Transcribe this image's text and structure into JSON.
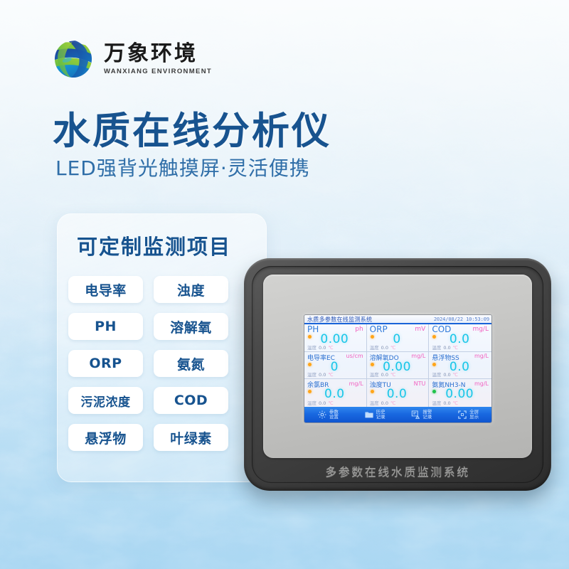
{
  "brand": {
    "logo_icon": "globe-swirl-logo-icon",
    "name_cn": "万象环境",
    "name_en": "WANXIANG ENVIRONMENT",
    "color_blue": "#1b4f9c",
    "color_green": "#8cc63e"
  },
  "hero": {
    "title": "水质在线分析仪",
    "subtitle": "LED强背光触摸屏·灵活便携",
    "title_color": "#18538f",
    "subtitle_color": "#2f6ea8"
  },
  "items_panel": {
    "title": "可定制监测项目",
    "tags": [
      {
        "label": "电导率"
      },
      {
        "label": "浊度"
      },
      {
        "label": "PH"
      },
      {
        "label": "溶解氧"
      },
      {
        "label": "ORP"
      },
      {
        "label": "氨氮"
      },
      {
        "label": "污泥浓度"
      },
      {
        "label": "COD"
      },
      {
        "label": "悬浮物"
      },
      {
        "label": "叶绿素"
      }
    ]
  },
  "device": {
    "caption": "多参数在线水质监测系统",
    "bezel_color": "#3e3e3e",
    "face_color": "#c6c6c4",
    "screen": {
      "system_title": "水质多参数在线监测系统",
      "timestamp": "2024/08/22 10:53:09",
      "accent_color": "#1963d8",
      "value_color": "#18c6e8",
      "unit_color": "#f261c0",
      "cells": [
        {
          "name": "PH",
          "unit": "ph",
          "value": "0.00",
          "temp_label": "温度",
          "temp_value": "0.0",
          "temp_unit": "℃",
          "status": "orange",
          "emphasis": "big"
        },
        {
          "name": "ORP",
          "unit": "mV",
          "value": "0",
          "temp_label": "温度",
          "temp_value": "0.0",
          "temp_unit": "℃",
          "status": "orange",
          "emphasis": "big"
        },
        {
          "name": "COD",
          "unit": "mg/L",
          "value": "0.0",
          "temp_label": "温度",
          "temp_value": "0.0",
          "temp_unit": "℃",
          "status": "orange",
          "emphasis": "big"
        },
        {
          "name": "电导率EC",
          "unit": "us/cm",
          "value": "0",
          "temp_label": "温度",
          "temp_value": "0.0",
          "temp_unit": "℃",
          "status": "orange",
          "emphasis": "small"
        },
        {
          "name": "溶解氧DO",
          "unit": "mg/L",
          "value": "0.00",
          "temp_label": "温度",
          "temp_value": "0.0",
          "temp_unit": "℃",
          "status": "orange",
          "emphasis": "small"
        },
        {
          "name": "悬浮物SS",
          "unit": "mg/L",
          "value": "0.0",
          "temp_label": "温度",
          "temp_value": "0.0",
          "temp_unit": "℃",
          "status": "orange",
          "emphasis": "small"
        },
        {
          "name": "余氯BR",
          "unit": "mg/L",
          "value": "0.0",
          "temp_label": "温度",
          "temp_value": "0.0",
          "temp_unit": "℃",
          "status": "orange",
          "emphasis": "small"
        },
        {
          "name": "浊度TU",
          "unit": "NTU",
          "value": "0.0",
          "temp_label": "温度",
          "temp_value": "0.0",
          "temp_unit": "℃",
          "status": "orange",
          "emphasis": "small"
        },
        {
          "name": "氨氮NH3-N",
          "unit": "mg/L",
          "value": "0.00",
          "temp_label": "温度",
          "temp_value": "0.0",
          "temp_unit": "℃",
          "status": "green",
          "emphasis": "small"
        }
      ],
      "toolbar": [
        {
          "label": "参数\n设置",
          "icon": "gear-icon"
        },
        {
          "label": "历史\n记录",
          "icon": "folder-icon"
        },
        {
          "label": "报警\n记录",
          "icon": "alarm-document-icon"
        },
        {
          "label": "全屏\n显示",
          "icon": "fullscreen-icon"
        }
      ]
    }
  }
}
